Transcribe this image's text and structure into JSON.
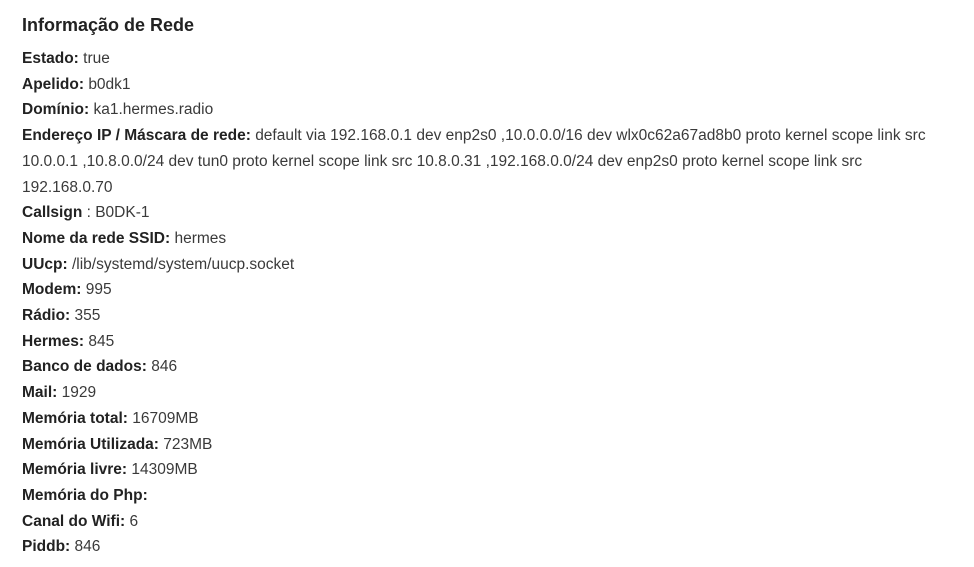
{
  "title": "Informação de Rede",
  "fields": {
    "status": {
      "label": "Estado:",
      "value": "true"
    },
    "nickname": {
      "label": "Apelido:",
      "value": "b0dk1"
    },
    "domain": {
      "label": "Domínio:",
      "value": "ka1.hermes.radio"
    },
    "ip_mask": {
      "label": "Endereço IP / Máscara de rede:",
      "value": "default via 192.168.0.1 dev enp2s0 ,10.0.0.0/16 dev wlx0c62a67ad8b0 proto kernel scope link src 10.0.0.1 ,10.8.0.0/24 dev tun0 proto kernel scope link src 10.8.0.31 ,192.168.0.0/24 dev enp2s0 proto kernel scope link src 192.168.0.70"
    },
    "callsign": {
      "label": "Callsign",
      "value": ": B0DK-1"
    },
    "ssid": {
      "label": "Nome da rede SSID:",
      "value": "hermes"
    },
    "uucp": {
      "label": "UUcp:",
      "value": "/lib/systemd/system/uucp.socket"
    },
    "modem": {
      "label": "Modem:",
      "value": "995"
    },
    "radio": {
      "label": "Rádio:",
      "value": "355"
    },
    "hermes": {
      "label": "Hermes:",
      "value": "845"
    },
    "database": {
      "label": "Banco de dados:",
      "value": "846"
    },
    "mail": {
      "label": "Mail:",
      "value": "1929"
    },
    "mem_total": {
      "label": "Memória total:",
      "value": "16709MB"
    },
    "mem_used": {
      "label": "Memória Utilizada:",
      "value": "723MB"
    },
    "mem_free": {
      "label": "Memória livre:",
      "value": "14309MB"
    },
    "mem_php": {
      "label": "Memória do Php:",
      "value": ""
    },
    "wifi_channel": {
      "label": "Canal do Wifi:",
      "value": "6"
    },
    "piddb": {
      "label": "Piddb:",
      "value": "846"
    }
  }
}
